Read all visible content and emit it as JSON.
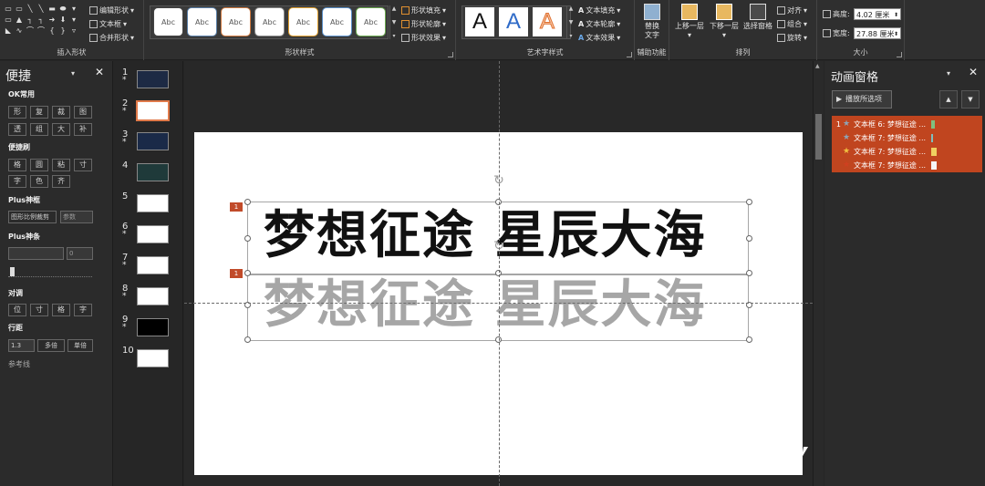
{
  "ribbon": {
    "insert_shapes": {
      "label": "插入形状",
      "edit_shape": "编辑形状",
      "text_box": "文本框",
      "merge_shapes": "合并形状"
    },
    "shape_styles": {
      "label": "形状样式",
      "gallery": [
        "Abc",
        "Abc",
        "Abc",
        "Abc",
        "Abc",
        "Abc",
        "Abc"
      ],
      "fill": "形状填充",
      "outline": "形状轮廓",
      "effects": "形状效果"
    },
    "wordart": {
      "label": "艺术字样式",
      "samples": [
        "A",
        "A",
        "A"
      ],
      "text_fill": "文本填充",
      "text_outline": "文本轮廓",
      "text_effects": "文本效果"
    },
    "accessibility": {
      "label": "辅助功能",
      "alt_text_line1": "替换",
      "alt_text_line2": "文字"
    },
    "arrange": {
      "label": "排列",
      "bring_forward": "上移一层",
      "send_backward": "下移一层",
      "selection_pane": "选择窗格",
      "align": "对齐",
      "group": "组合",
      "rotate": "旋转"
    },
    "size": {
      "label": "大小",
      "height_label": "高度:",
      "height_value": "4.02 厘米",
      "width_label": "宽度:",
      "width_value": "27.88 厘米"
    }
  },
  "quick_panel": {
    "title": "便捷",
    "ok_common": {
      "heading": "OK常用",
      "buttons": [
        "形",
        "复",
        "裁",
        "图",
        "透",
        "组",
        "大",
        "补"
      ]
    },
    "brush": {
      "heading": "便捷刷",
      "buttons": [
        "格",
        "圆",
        "粘",
        "寸",
        "字",
        "色",
        "齐"
      ]
    },
    "plus_crop": {
      "heading": "Plus神框",
      "ratio_crop": "图形比例裁剪",
      "param": "参数"
    },
    "plus_bar": {
      "heading": "Plus神条",
      "value": "0"
    },
    "align": {
      "heading": "对调",
      "buttons": [
        "位",
        "寸",
        "格",
        "字"
      ]
    },
    "line_spacing": {
      "heading": "行距",
      "value": "1.3",
      "multiple": "多倍",
      "single": "单倍"
    },
    "guides": "参考线"
  },
  "thumbnails": [
    {
      "num": "1",
      "star": "*"
    },
    {
      "num": "2",
      "star": "*"
    },
    {
      "num": "3",
      "star": "*"
    },
    {
      "num": "4",
      "star": ""
    },
    {
      "num": "5",
      "star": ""
    },
    {
      "num": "6",
      "star": "*"
    },
    {
      "num": "7",
      "star": "*"
    },
    {
      "num": "8",
      "star": "*"
    },
    {
      "num": "9",
      "star": "*"
    },
    {
      "num": "10",
      "star": ""
    }
  ],
  "slide": {
    "line1": "梦想征途 星辰大海",
    "line2": "梦想征途 星辰大海",
    "tag1": "1",
    "tag2": "1",
    "line1_color": "#111111",
    "line2_color": "#a6a6a6"
  },
  "animation_pane": {
    "title": "动画窗格",
    "play_button": "播放所选项",
    "up": "▲",
    "down": "▼",
    "items": [
      {
        "num": "1",
        "star_color": "#8fa3b5",
        "text": "文本框 6: 梦想征途 ...",
        "bar_color": "#7fbf7f"
      },
      {
        "num": "",
        "star_color": "#8fa3b5",
        "text": "文本框 7: 梦想征途 ...",
        "bar_color": "#7fbfbf"
      },
      {
        "num": "",
        "star_color": "#f0c040",
        "text": "文本框 7: 梦想征途 ...",
        "bar_color": "#f0d060"
      },
      {
        "num": "",
        "star_color": "#d04020",
        "text": "文本框 7: 梦想征途 ...",
        "bar_color": "#f5f5f5"
      }
    ],
    "accent": "#c0451f"
  }
}
